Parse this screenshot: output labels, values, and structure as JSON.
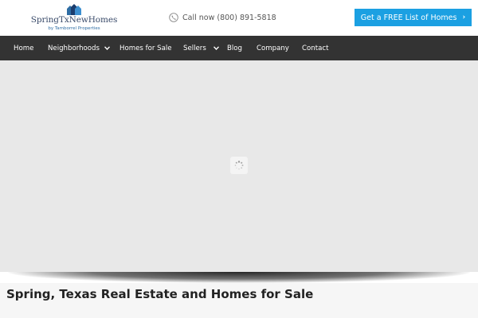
{
  "brand": {
    "name": "SpringTxNewHomes",
    "tagline": "by Tamborrel Properties"
  },
  "contact": {
    "call_text": "Call now (800) 891-5818",
    "icon": "phone-icon"
  },
  "cta": {
    "label": "Get a FREE List of Homes",
    "arrow": "›"
  },
  "nav": {
    "items": [
      {
        "label": "Home",
        "has_dropdown": false
      },
      {
        "label": "Neighborhoods",
        "has_dropdown": true
      },
      {
        "label": "Homes for Sale",
        "has_dropdown": false
      },
      {
        "label": "Sellers",
        "has_dropdown": true
      },
      {
        "label": "Blog",
        "has_dropdown": false
      },
      {
        "label": "Company",
        "has_dropdown": false
      },
      {
        "label": "Contact",
        "has_dropdown": false
      }
    ]
  },
  "hero": {
    "state": "loading",
    "icon": "spinner-icon"
  },
  "page": {
    "title": "Spring, Texas Real Estate and Homes for Sale"
  },
  "colors": {
    "accent": "#1ba0e2",
    "nav_bg": "#333333",
    "hero_bg": "#e8e8e8",
    "brand_text": "#3a4b6a"
  }
}
